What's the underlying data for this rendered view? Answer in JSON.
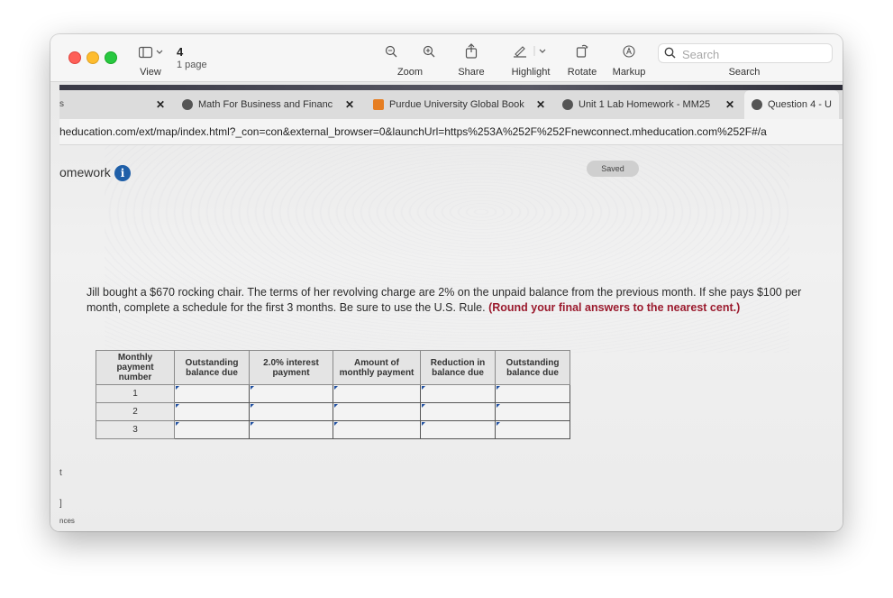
{
  "toolbar": {
    "view_label": "View",
    "doc_title": "4",
    "doc_subtitle": "1 page",
    "zoom_label": "Zoom",
    "share_label": "Share",
    "highlight_label": "Highlight",
    "rotate_label": "Rotate",
    "markup_label": "Markup",
    "search_label": "Search",
    "search_placeholder": "Search"
  },
  "browser": {
    "tabs": [
      {
        "title": "Math For Business and Financ",
        "icon": "globe-icon"
      },
      {
        "title": "Purdue University Global Book",
        "icon": "bookmark-icon"
      },
      {
        "title": "Unit 1 Lab Homework - MM25",
        "icon": "globe-icon"
      },
      {
        "title": "Question 4 - U",
        "icon": "globe-icon"
      }
    ],
    "url": "heducation.com/ext/map/index.html?_con=con&external_browser=0&launchUrl=https%253A%252F%252Fnewconnect.mheducation.com%252F#/a"
  },
  "page": {
    "homework_label": "omework",
    "saved_label": "Saved",
    "problem_text": "Jill bought a $670 rocking chair. The terms of her revolving charge are 2% on the unpaid balance from the previous month. If she pays $100 per month, complete a schedule for the first 3 months. Be sure to use the U.S. Rule. ",
    "problem_emphasis": "(Round your final answers to the nearest cent.)",
    "table": {
      "headers": [
        "Monthly payment number",
        "Outstanding balance due",
        "2.0% interest payment",
        "Amount of monthly payment",
        "Reduction in balance due",
        "Outstanding balance due"
      ],
      "rows": [
        "1",
        "2",
        "3"
      ]
    },
    "left_edge_texts": [
      "s",
      "t",
      "]",
      "nces"
    ]
  }
}
